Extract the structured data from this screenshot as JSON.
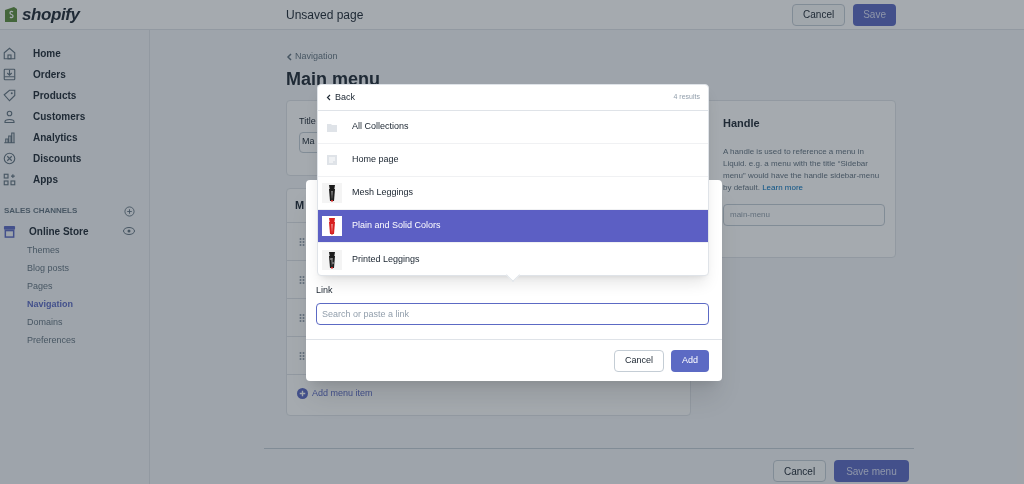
{
  "top_bar": {
    "logo": "shopify",
    "page_title": "Unsaved page",
    "buttons": [
      "Cancel",
      "Save"
    ]
  },
  "sidebar": {
    "items": [
      {
        "label": "Home",
        "kind": "home"
      },
      {
        "label": "Orders",
        "kind": "orders"
      },
      {
        "label": "Products",
        "kind": "products"
      },
      {
        "label": "Customers",
        "kind": "customers"
      },
      {
        "label": "Analytics",
        "kind": "analytics"
      },
      {
        "label": "Discounts",
        "kind": "discounts"
      },
      {
        "label": "Apps",
        "kind": "apps"
      }
    ],
    "section_title": "SALES CHANNELS",
    "channel": "Online Store",
    "subitems": [
      {
        "label": "Themes",
        "selected": false
      },
      {
        "label": "Blog posts",
        "selected": false
      },
      {
        "label": "Pages",
        "selected": false
      },
      {
        "label": "Navigation",
        "selected": true
      },
      {
        "label": "Domains",
        "selected": false
      },
      {
        "label": "Preferences",
        "selected": false
      }
    ]
  },
  "page": {
    "breadcrumb": "Navigation",
    "title": "Main menu",
    "title_card": {
      "label": "Title",
      "value": "Ma"
    },
    "menu_card": {
      "heading": "M",
      "add_label": "Add menu item"
    },
    "handle_card": {
      "heading": "Handle",
      "description": "A handle is used to reference a menu in Liquid. e.g. a menu with the title “Sidebar menu” would have the handle sidebar-menu by default.",
      "link": "Learn more",
      "value": "main-menu"
    },
    "footer_buttons": [
      "Cancel",
      "Save menu"
    ]
  },
  "modal": {
    "link_label": "Link",
    "link_placeholder": "Search or paste a link",
    "buttons": [
      "Cancel",
      "Add"
    ],
    "dropdown": {
      "back": "Back",
      "count": "4 results",
      "results": [
        {
          "label": "All Collections",
          "kind": "collection",
          "selected": false
        },
        {
          "label": "Home page",
          "kind": "page",
          "selected": false
        },
        {
          "label": "Mesh Leggings",
          "kind": "product",
          "selected": false
        },
        {
          "label": "Plain and Solid Colors",
          "kind": "product",
          "selected": true
        },
        {
          "label": "Printed Leggings",
          "kind": "product",
          "selected": false
        }
      ]
    }
  }
}
